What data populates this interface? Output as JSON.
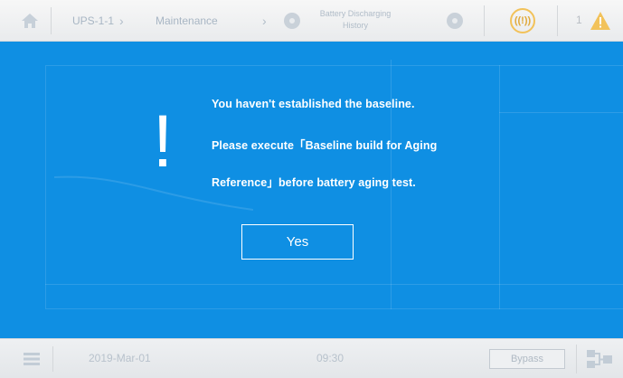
{
  "header": {
    "home_icon": "home-icon",
    "breadcrumb": {
      "item1": "UPS-1-1",
      "item2": "Maintenance",
      "item3_line1": "Battery Discharging",
      "item3_line2": "History"
    },
    "alarm_label": "((!))",
    "alarm_count": "1",
    "warning_icon": "warning-triangle-icon"
  },
  "dialog": {
    "icon": "!",
    "message": {
      "line1": "You haven't established the baseline.",
      "line2": "Please execute「Baseline build for Aging",
      "line3": "Reference」before battery aging test."
    },
    "yes_label": "Yes"
  },
  "footer": {
    "menu_icon": "menu-icon",
    "date": "2019-Mar-01",
    "time": "09:30",
    "bypass_label": "Bypass",
    "flow_icon": "flow-diagram-icon"
  },
  "colors": {
    "dialog_background": "#0f8fe3",
    "dialog_text": "#ffffff",
    "alarm_accent": "#f2c25a",
    "bar_background": "#eef0f2"
  }
}
